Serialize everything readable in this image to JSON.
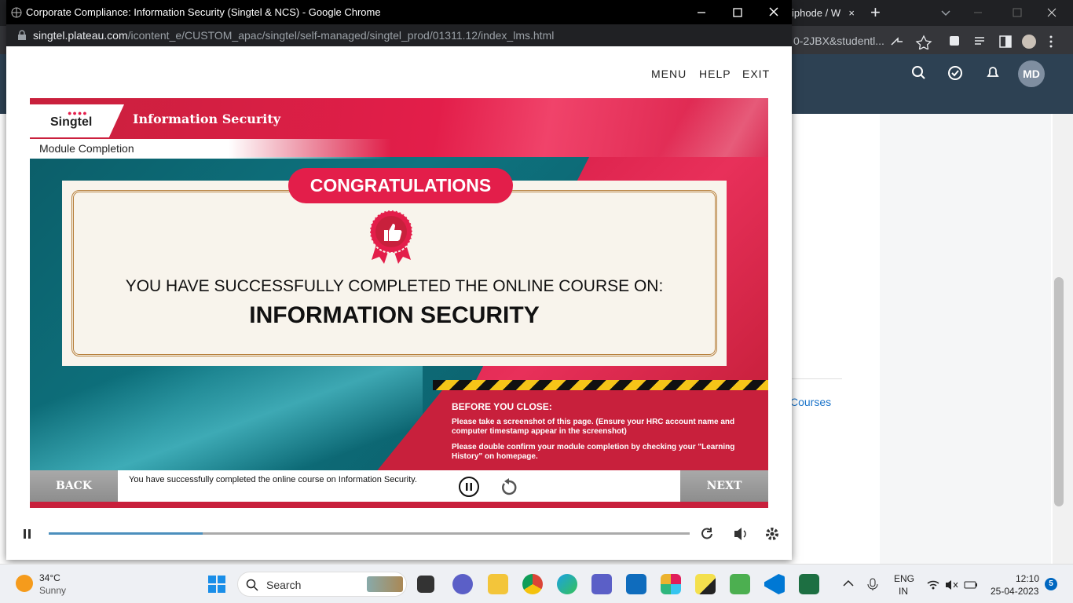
{
  "background_browser": {
    "tab_title": "iphode / W",
    "tab_close": "×",
    "new_tab": "+",
    "url": "0-2JBX&studentl...",
    "header_avatar": "MD",
    "sidebar_link": "Courses"
  },
  "popup": {
    "window_title": "Corporate Compliance: Information Security (Singtel & NCS) - Google Chrome",
    "url_domain": "singtel.plateau.com",
    "url_path": "/icontent_e/CUSTOM_apac/singtel/self-managed/singtel_prod/01311.12/index_lms.html",
    "nav": {
      "menu": "MENU",
      "help": "HELP",
      "exit": "EXIT"
    }
  },
  "course": {
    "logo": "Singtel",
    "title": "Information Security",
    "section": "Module Completion",
    "badge": "CONGRATULATIONS",
    "message_line1": "YOU HAVE SUCCESSFULLY COMPLETED THE ONLINE COURSE ON:",
    "message_line2": "INFORMATION SECURITY",
    "before_heading": "BEFORE YOU CLOSE:",
    "before_p1": "Please take a screenshot of this page. (Ensure your HRC account name and computer timestamp appear in the screenshot)",
    "before_p2": "Please double confirm your module completion by checking your \"Learning History\" on homepage.",
    "back": "BACK",
    "next": "NEXT",
    "caption": "You have successfully completed the online course on Information Security."
  },
  "player": {
    "progress": 0.24
  },
  "taskbar": {
    "weather_temp": "34°C",
    "weather_desc": "Sunny",
    "search_placeholder": "Search",
    "lang1": "ENG",
    "lang2": "IN",
    "time": "12:10",
    "date": "25-04-2023",
    "notifications": "5"
  },
  "colors": {
    "accent": "#e31e4a",
    "teal": "#0e7480",
    "header": "#2d4153"
  }
}
